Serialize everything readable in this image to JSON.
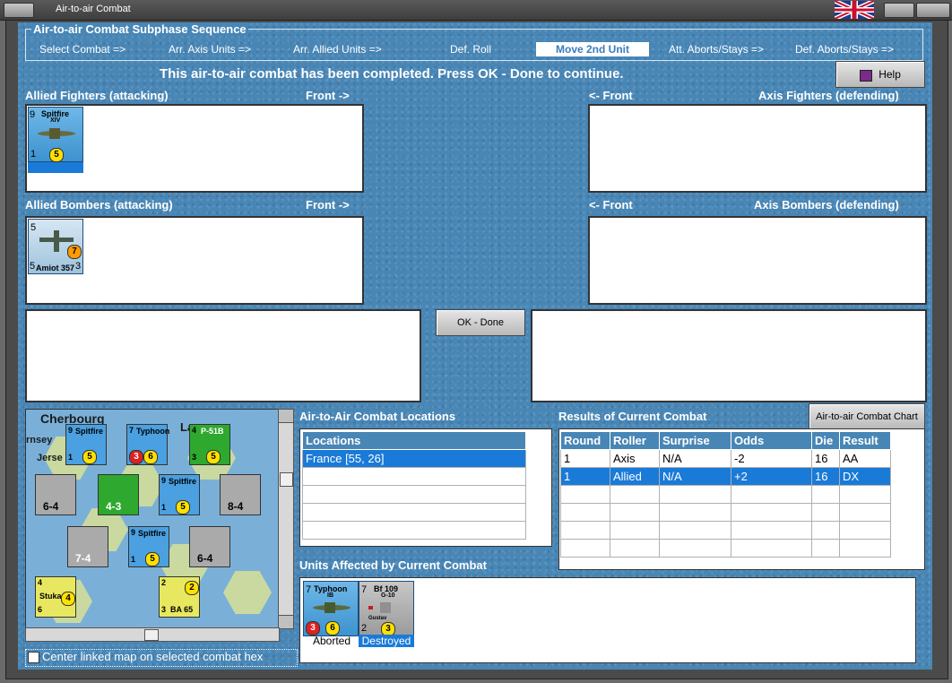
{
  "window": {
    "title": "Air-to-air Combat"
  },
  "phase": {
    "title": "Air-to-air Combat Subphase Sequence",
    "steps": [
      "Select Combat =>",
      "Arr. Axis Units =>",
      "Arr. Allied Units =>",
      "Def. Roll",
      "Move 2nd Unit",
      "Att. Aborts/Stays =>",
      "Def. Aborts/Stays =>"
    ]
  },
  "message": "This air-to-air combat has been completed.  Press OK - Done to continue.",
  "help_label": "Help",
  "panels": {
    "allied_fighters": "Allied Fighters (attacking)",
    "allied_fighters_front": "Front ->",
    "axis_fighters_front": "<- Front",
    "axis_fighters": "Axis Fighters (defending)",
    "allied_bombers": "Allied Bombers (attacking)",
    "allied_bombers_front": "Front ->",
    "axis_bombers_front": "<- Front",
    "axis_bombers": "Axis Bombers (defending)"
  },
  "counters": {
    "spitfire": {
      "name": "Spitfire",
      "sub": "XIV",
      "top_left": "9",
      "bottom_left": "1",
      "coin": "5"
    },
    "amiot": {
      "name": "Amiot 357",
      "top_left": "5",
      "bottom_left": "5",
      "coin": "7",
      "bottom_right": "3"
    }
  },
  "ok_label": "OK - Done",
  "locations": {
    "title": "Air-to-Air Combat Locations",
    "header": "Locations",
    "rows": [
      "France [55, 26]"
    ]
  },
  "results": {
    "title": "Results of Current Combat",
    "chart_button": "Air-to-air Combat Chart",
    "headers": [
      "Round",
      "Roller",
      "Surprise",
      "Odds",
      "Die",
      "Result"
    ],
    "rows": [
      [
        "1",
        "Axis",
        "N/A",
        "-2",
        "16",
        "AA"
      ],
      [
        "1",
        "Allied",
        "N/A",
        "+2",
        "16",
        "DX"
      ]
    ]
  },
  "affected": {
    "title": "Units Affected by Current Combat",
    "typhoon": {
      "name": "Typhoon",
      "sub": "IB",
      "top_left": "7",
      "coin_red": "3",
      "coin": "6",
      "status": "Aborted"
    },
    "bf109": {
      "name": "Bf 109",
      "sub": "G-10",
      "top_left": "7",
      "bottom_left": "2",
      "coin": "3",
      "note": "Gustav",
      "status": "Destroyed"
    }
  },
  "map": {
    "labels": [
      "Cherbourg",
      "rnsey",
      "Jerse",
      "La"
    ],
    "units": [
      {
        "name": "Spitfire",
        "a": "9",
        "b": "1",
        "coin": "5"
      },
      {
        "name": "Typhoon",
        "a": "7",
        "b": "3",
        "coin": "6"
      },
      {
        "name": "P-51B",
        "a": "4",
        "b": "3",
        "coin": "5"
      },
      {
        "name": "Spitfire",
        "a": "9",
        "b": "1",
        "coin": "5"
      },
      {
        "name": "Spitfire",
        "a": "9",
        "b": "1",
        "coin": "5"
      },
      {
        "name": "Stuka",
        "a": "4",
        "b": "6",
        "coin": "4"
      },
      {
        "name": "BA 65",
        "a": "2",
        "b": "3",
        "coin": "2"
      }
    ],
    "strengths": [
      "6-4",
      "4-3",
      "8-4",
      "7-4",
      "6-4"
    ]
  },
  "center_checkbox": "Center linked map on selected combat hex"
}
